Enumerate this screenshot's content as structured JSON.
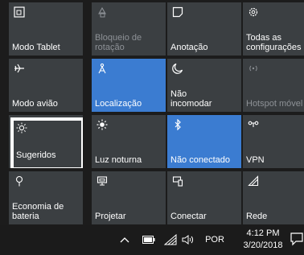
{
  "tiles": [
    {
      "label": "Modo Tablet",
      "icon": "tablet-mode-icon",
      "state": "normal"
    },
    {
      "label": "Bloqueio de\nrotação",
      "icon": "rotation-lock-icon",
      "state": "disabled"
    },
    {
      "label": "Anotação",
      "icon": "note-icon",
      "state": "normal"
    },
    {
      "label": "Todas as\nconfigurações",
      "icon": "settings-gear-icon",
      "state": "normal"
    },
    {
      "label": "Modo avião",
      "icon": "airplane-icon",
      "state": "normal"
    },
    {
      "label": "Localização",
      "icon": "location-icon",
      "state": "on"
    },
    {
      "label": "Não\nincomodar",
      "icon": "moon-icon",
      "state": "normal"
    },
    {
      "label": "Hotspot móvel",
      "icon": "hotspot-icon",
      "state": "disabled"
    },
    {
      "label": "Sugeridos",
      "icon": "brightness-icon",
      "state": "focused"
    },
    {
      "label": "Luz noturna",
      "icon": "night-light-icon",
      "state": "normal"
    },
    {
      "label": "Não conectado",
      "icon": "bluetooth-icon",
      "state": "on"
    },
    {
      "label": "VPN",
      "icon": "vpn-icon",
      "state": "normal"
    },
    {
      "label": "Economia de\nbateria",
      "icon": "battery-saver-icon",
      "state": "normal"
    },
    {
      "label": "Projetar",
      "icon": "project-icon",
      "state": "normal"
    },
    {
      "label": "Conectar",
      "icon": "connect-icon",
      "state": "normal"
    },
    {
      "label": "Rede",
      "icon": "network-icon",
      "state": "normal"
    }
  ],
  "taskbar": {
    "language": "POR",
    "time": "4:12 PM",
    "date": "3/20/2018",
    "icons": [
      "chevron-up-icon",
      "battery-icon",
      "wifi-icon",
      "volume-icon",
      "notification-icon"
    ]
  },
  "colors": {
    "tile_default": "#3b3f42",
    "tile_active": "#3b7cd1",
    "background": "#1c1c1c",
    "disabled_text": "#8d9196"
  }
}
